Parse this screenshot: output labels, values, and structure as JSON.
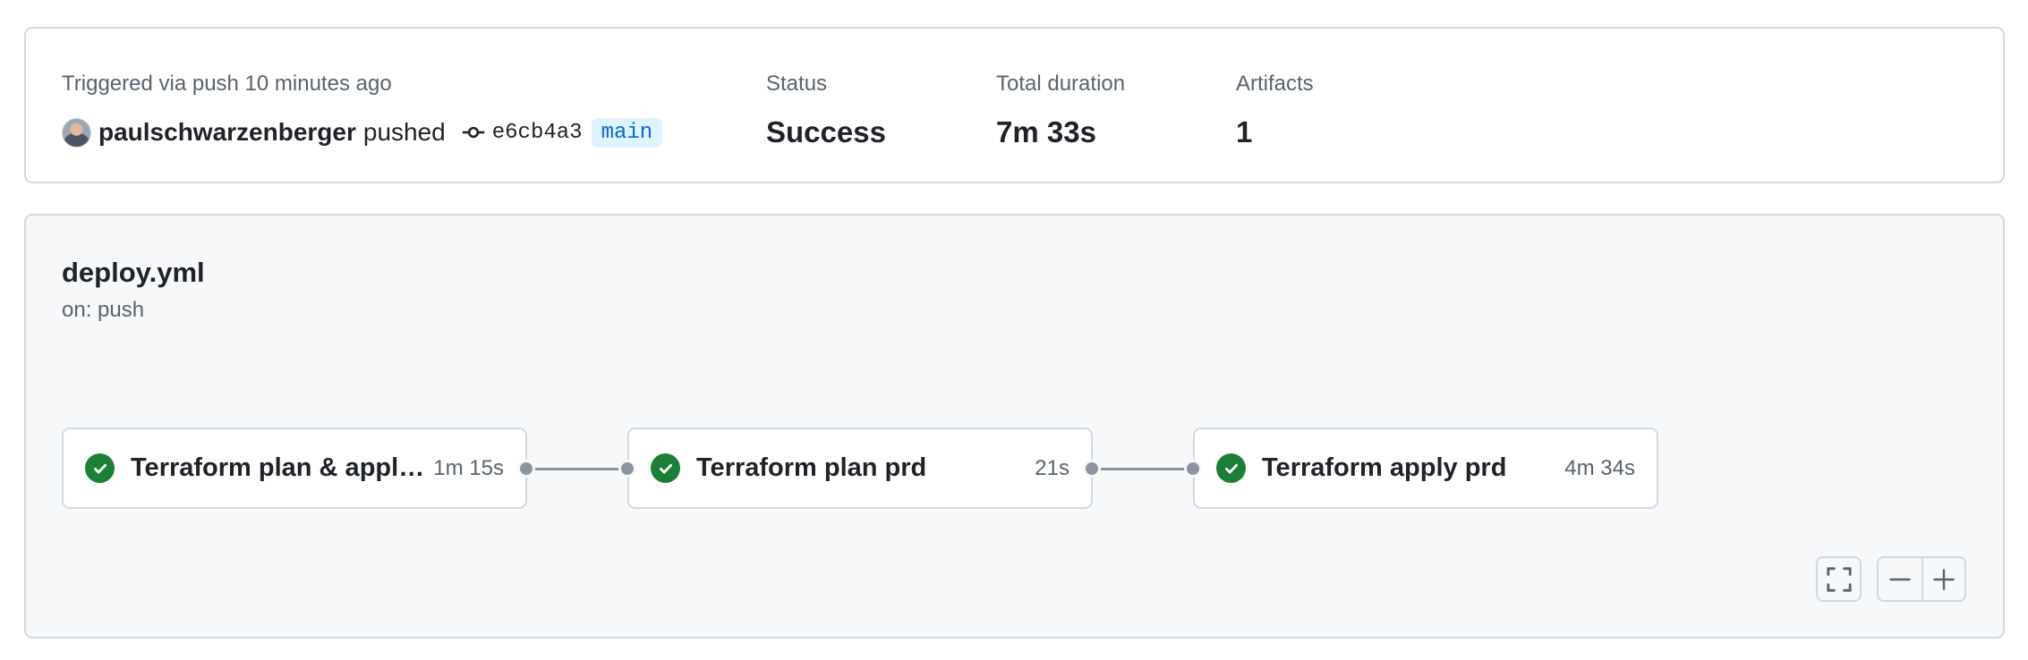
{
  "summary": {
    "trigger_text": "Triggered via push 10 minutes ago",
    "actor": "paulschwarzenberger",
    "action": "pushed",
    "commit_sha": "e6cb4a3",
    "branch": "main",
    "status_label": "Status",
    "status_value": "Success",
    "duration_label": "Total duration",
    "duration_value": "7m 33s",
    "artifacts_label": "Artifacts",
    "artifacts_value": "1"
  },
  "workflow": {
    "file": "deploy.yml",
    "trigger": "on: push",
    "jobs": [
      {
        "name": "Terraform plan & apply ...",
        "duration": "1m 15s",
        "status": "success",
        "status_icon": "check-circle-icon"
      },
      {
        "name": "Terraform plan prd",
        "duration": "21s",
        "status": "success",
        "status_icon": "check-circle-icon"
      },
      {
        "name": "Terraform apply prd",
        "duration": "4m 34s",
        "status": "success",
        "status_icon": "check-circle-icon"
      }
    ]
  },
  "controls": {
    "fullscreen_icon": "fullscreen-icon",
    "zoom_out_icon": "zoom-out-icon",
    "zoom_in_icon": "zoom-in-icon"
  },
  "colors": {
    "success": "#1a7f37",
    "branch_text": "#0969da",
    "branch_bg": "#ddf4ff",
    "border": "#d1d9e0",
    "canvas_bg": "#f6f8fa",
    "connector": "#8c959f"
  }
}
